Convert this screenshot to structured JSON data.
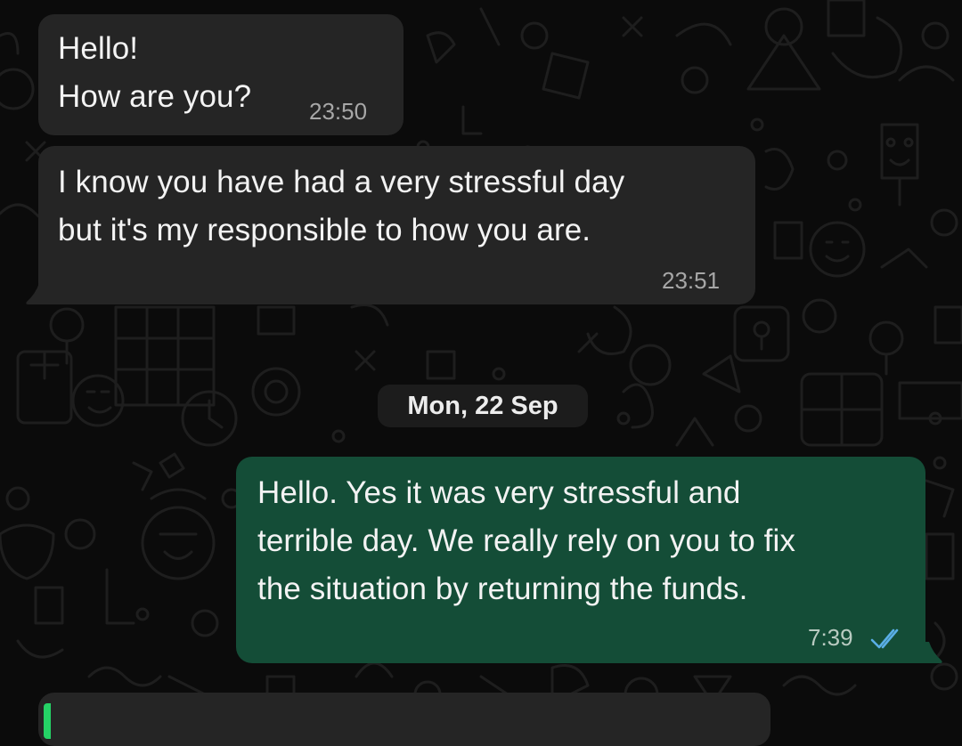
{
  "messages": [
    {
      "direction": "incoming",
      "text": "Hello!\nHow are you?",
      "time": "23:50"
    },
    {
      "direction": "incoming",
      "text": "I know you have had a very stressful day\nbut it's my responsible to how you are.",
      "time": "23:51"
    },
    {
      "direction": "outgoing",
      "text": "Hello. Yes it was very stressful and\nterrible day. We really rely on you to fix\nthe situation by returning the funds.",
      "time": "7:39",
      "status": "read"
    }
  ],
  "date_separator": "Mon, 22 Sep",
  "colors": {
    "background": "#0b0b0b",
    "incoming_bubble": "#252525",
    "outgoing_bubble": "#144d37",
    "read_ticks": "#5aaee6",
    "reply_accent": "#25d366"
  },
  "icons": {
    "read_receipt": "double-check-icon",
    "wallpaper": "doodle-pattern"
  }
}
